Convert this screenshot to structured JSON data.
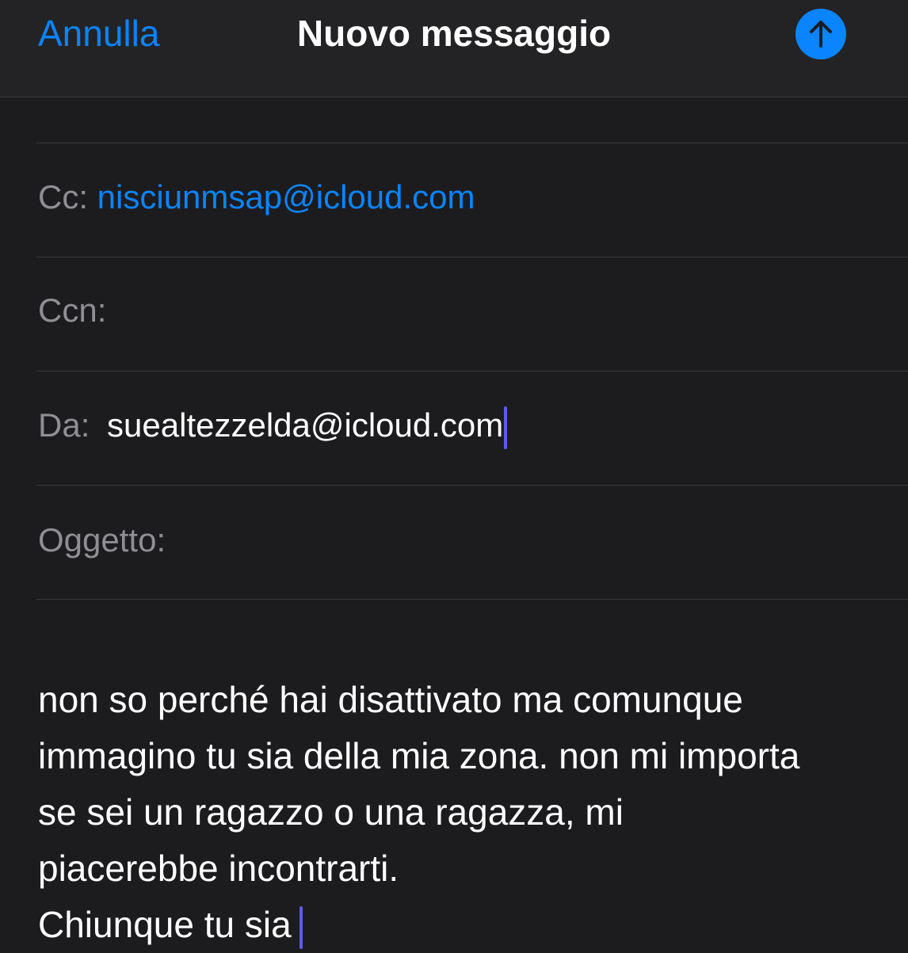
{
  "header": {
    "cancel_label": "Annulla",
    "title": "Nuovo messaggio",
    "send_icon": "arrow-up-icon",
    "accent_color": "#0a84ff"
  },
  "fields": {
    "cc": {
      "label": "Cc:",
      "value": "nisciunmsap@icloud.com"
    },
    "bcc": {
      "label": "Ccn:",
      "value": ""
    },
    "from": {
      "label": "Da:",
      "value": "suealtezzelda@icloud.com"
    },
    "subject": {
      "label": "Oggetto:",
      "value": ""
    }
  },
  "message": {
    "lines": [
      "non so perché hai disattivato ma comunque",
      "immagino tu sia della mia zona. non mi importa",
      "se sei un ragazzo o una ragazza, mi",
      "piacerebbe incontrarti.",
      "Chiunque tu sia"
    ]
  }
}
